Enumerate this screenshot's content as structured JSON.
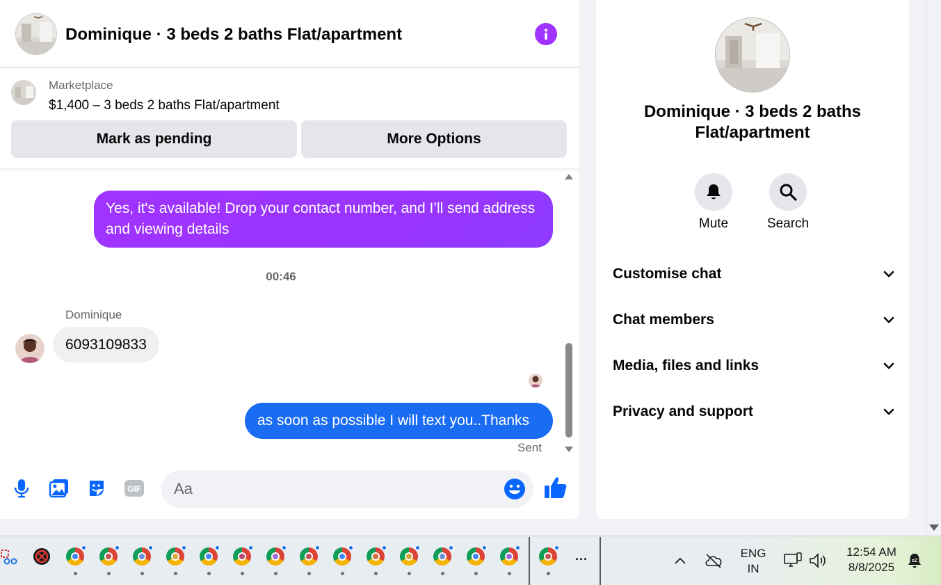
{
  "chat": {
    "title": "Dominique · 3 beds 2 baths Flat/apartment",
    "listing": {
      "label": "Marketplace",
      "price_line": "$1,400 – 3 beds 2 baths Flat/apartment",
      "mark_pending": "Mark as pending",
      "more_options": "More Options"
    },
    "messages": {
      "outgoing_1": "Yes, it's available! Drop your contact number, and I’ll send address and viewing details",
      "timestamp": "00:46",
      "sender_name": "Dominique",
      "incoming_1": "6093109833",
      "outgoing_2": "as soon as possible I will text you..Thanks",
      "status": "Sent"
    },
    "composer": {
      "placeholder": "Aa"
    }
  },
  "info_panel": {
    "title": "Dominique · 3 beds 2 baths Flat/apartment",
    "mute_label": "Mute",
    "search_label": "Search",
    "sections": [
      "Customise chat",
      "Chat members",
      "Media, files and links",
      "Privacy and support"
    ]
  },
  "taskbar": {
    "lang_top": "ENG",
    "lang_bottom": "IN",
    "time": "12:54 AM",
    "date": "8/8/2025",
    "overflow": "···"
  },
  "colors": {
    "messenger_purple": "#a033ff",
    "outgoing_blue": "#1a6cf2",
    "fb_blue": "#0866ff",
    "panel_gray": "#e4e6eb"
  }
}
